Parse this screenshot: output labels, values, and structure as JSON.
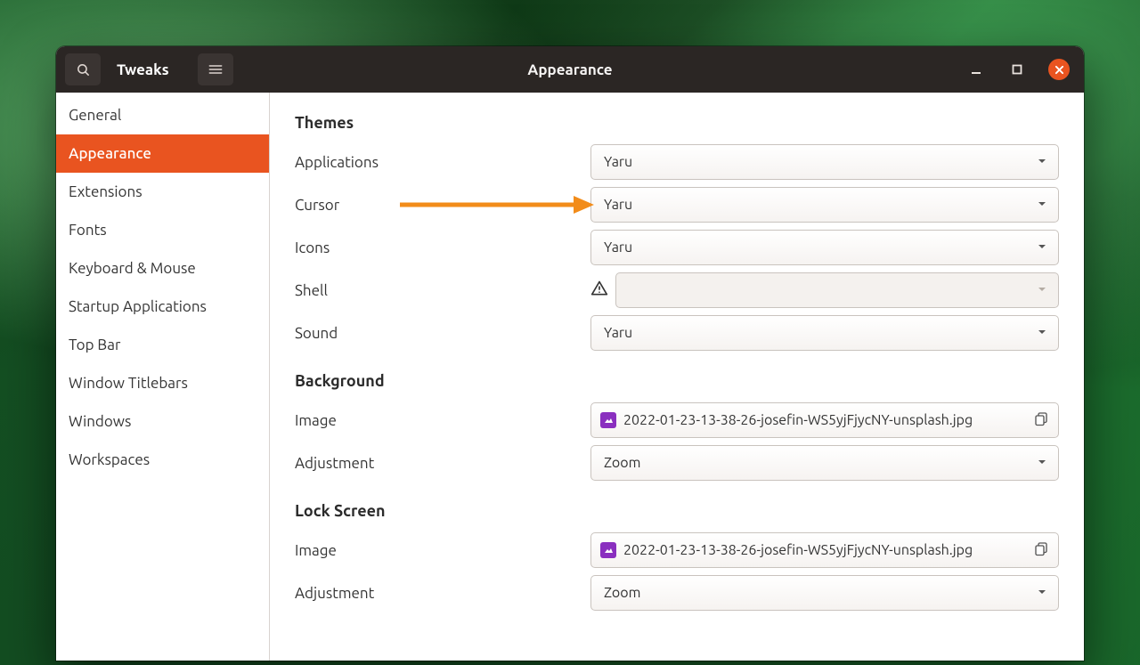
{
  "app": {
    "name": "Tweaks",
    "section_title": "Appearance"
  },
  "sidebar": {
    "items": [
      {
        "label": "General"
      },
      {
        "label": "Appearance"
      },
      {
        "label": "Extensions"
      },
      {
        "label": "Fonts"
      },
      {
        "label": "Keyboard & Mouse"
      },
      {
        "label": "Startup Applications"
      },
      {
        "label": "Top Bar"
      },
      {
        "label": "Window Titlebars"
      },
      {
        "label": "Windows"
      },
      {
        "label": "Workspaces"
      }
    ],
    "active_index": 1
  },
  "themes": {
    "title": "Themes",
    "rows": {
      "applications": {
        "label": "Applications",
        "value": "Yaru"
      },
      "cursor": {
        "label": "Cursor",
        "value": "Yaru"
      },
      "icons": {
        "label": "Icons",
        "value": "Yaru"
      },
      "shell": {
        "label": "Shell",
        "value": ""
      },
      "sound": {
        "label": "Sound",
        "value": "Yaru"
      }
    }
  },
  "background": {
    "title": "Background",
    "image_label": "Image",
    "image_value": "2022-01-23-13-38-26-josefin-WS5yjFjycNY-unsplash.jpg",
    "adjustment_label": "Adjustment",
    "adjustment_value": "Zoom"
  },
  "lockscreen": {
    "title": "Lock Screen",
    "image_label": "Image",
    "image_value": "2022-01-23-13-38-26-josefin-WS5yjFjycNY-unsplash.jpg",
    "adjustment_label": "Adjustment",
    "adjustment_value": "Zoom"
  }
}
